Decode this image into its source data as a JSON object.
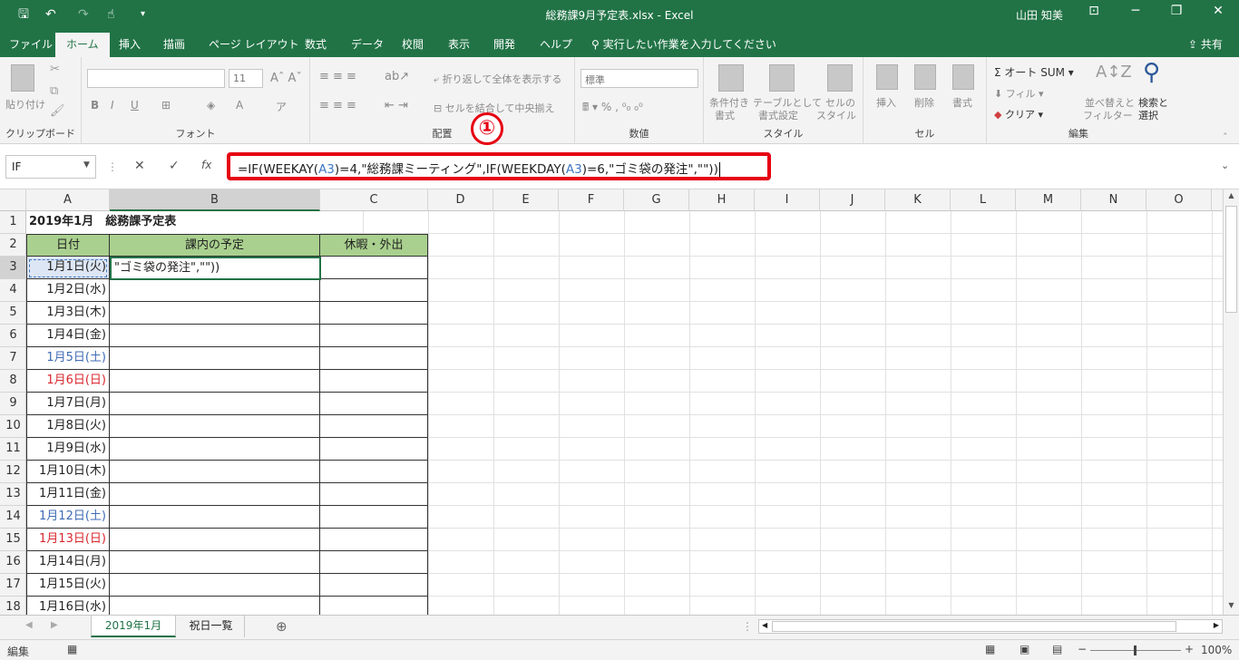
{
  "titlebar": {
    "title": "総務課9月予定表.xlsx - Excel",
    "user": "山田 知美"
  },
  "tabs": [
    "ファイル",
    "ホーム",
    "挿入",
    "描画",
    "ページ レイアウト",
    "数式",
    "データ",
    "校閲",
    "表示",
    "開発",
    "ヘルプ"
  ],
  "tellme": "実行したい作業を入力してください",
  "share": "共有",
  "ribbon": {
    "groups": [
      "クリップボード",
      "フォント",
      "配置",
      "数値",
      "スタイル",
      "セル",
      "編集"
    ],
    "paste": "貼り付け",
    "font_size": "11",
    "wrap": "折り返して全体を表示する",
    "merge": "セルを結合して中央揃え",
    "number_format": "標準",
    "cond1": "条件付き",
    "cond2": "書式",
    "table1": "テーブルとして",
    "table2": "書式設定",
    "style1": "セルの",
    "style2": "スタイル",
    "insert": "挿入",
    "delete": "削除",
    "format": "書式",
    "autosum": "オート SUM",
    "fill": "フィル",
    "clear": "クリア",
    "sort1": "並べ替えと",
    "sort2": "フィルター",
    "find1": "検索と",
    "find2": "選択"
  },
  "namebox": "IF",
  "fx": "fx",
  "formula": {
    "p1": "=IF(WEEKAY(",
    "r1": "A3",
    "p2": ")=4,\"総務課ミーティング\",IF(WEEKDAY(",
    "r2": "A3",
    "p3": ")=6,\"ゴミ袋の発注\",\"\"))"
  },
  "callout": "①",
  "columns": [
    "A",
    "B",
    "C",
    "D",
    "E",
    "F",
    "G",
    "H",
    "I",
    "J",
    "K",
    "L",
    "M",
    "N",
    "O"
  ],
  "rows": [
    "1",
    "2",
    "3",
    "4",
    "5",
    "6",
    "7",
    "8",
    "9",
    "10",
    "11",
    "12",
    "13",
    "14",
    "15",
    "16",
    "17",
    "18"
  ],
  "sheet": {
    "title": "2019年1月　総務課予定表",
    "headers": [
      "日付",
      "課内の予定",
      "休暇・外出"
    ],
    "editing_text": "\"ゴミ袋の発注\",\"\"))",
    "dates": [
      "1月1日(火)",
      "1月2日(水)",
      "1月3日(木)",
      "1月4日(金)",
      "1月5日(土)",
      "1月6日(日)",
      "1月7日(月)",
      "1月8日(火)",
      "1月9日(水)",
      "1月10日(木)",
      "1月11日(金)",
      "1月12日(土)",
      "1月13日(日)",
      "1月14日(月)",
      "1月15日(火)",
      "1月16日(水)"
    ],
    "date_colors": [
      "#222222",
      "#222222",
      "#222222",
      "#222222",
      "#3f6bb5",
      "#d9272e",
      "#222222",
      "#222222",
      "#222222",
      "#222222",
      "#222222",
      "#3f6bb5",
      "#d9272e",
      "#222222",
      "#222222",
      "#222222"
    ]
  },
  "sheettabs": [
    "2019年1月",
    "祝日一覧"
  ],
  "status": {
    "mode": "編集",
    "zoom": "100%"
  }
}
